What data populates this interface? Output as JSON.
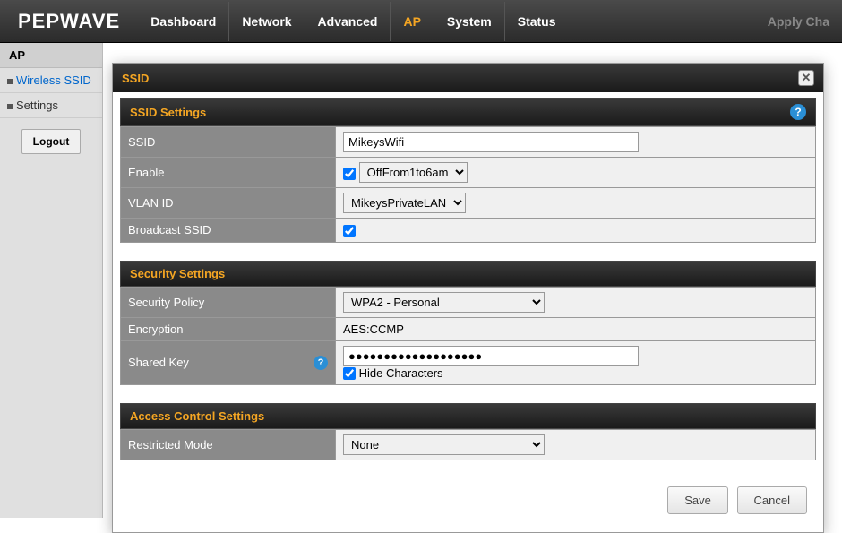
{
  "brand": "PEPWAVE",
  "nav": {
    "items": [
      "Dashboard",
      "Network",
      "Advanced",
      "AP",
      "System",
      "Status"
    ],
    "active": "AP",
    "apply": "Apply Cha"
  },
  "sidebar": {
    "title": "AP",
    "items": [
      {
        "label": "Wireless SSID",
        "active": true
      },
      {
        "label": "Settings",
        "active": false
      }
    ],
    "logout": "Logout"
  },
  "modal": {
    "title": "SSID",
    "sections": {
      "ssid": {
        "header": "SSID Settings",
        "rows": {
          "ssid": {
            "label": "SSID",
            "value": "MikeysWifi"
          },
          "enable": {
            "label": "Enable",
            "checked": true,
            "schedule": "OffFrom1to6am"
          },
          "vlan": {
            "label": "VLAN ID",
            "value": "MikeysPrivateLAN"
          },
          "broadcast": {
            "label": "Broadcast SSID",
            "checked": true
          }
        }
      },
      "security": {
        "header": "Security Settings",
        "rows": {
          "policy": {
            "label": "Security Policy",
            "value": "WPA2 - Personal"
          },
          "encryption": {
            "label": "Encryption",
            "value": "AES:CCMP"
          },
          "sharedkey": {
            "label": "Shared Key",
            "value": "●●●●●●●●●●●●●●●●●●●",
            "hide_label": "Hide Characters",
            "hide_checked": true
          }
        }
      },
      "access": {
        "header": "Access Control Settings",
        "rows": {
          "restricted": {
            "label": "Restricted Mode",
            "value": "None"
          }
        }
      }
    },
    "buttons": {
      "save": "Save",
      "cancel": "Cancel"
    }
  }
}
